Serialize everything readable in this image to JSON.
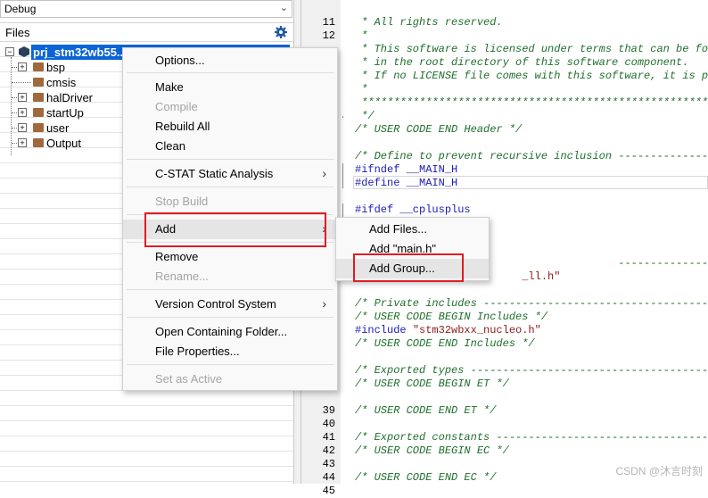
{
  "config": {
    "value": "Debug"
  },
  "files_panel": {
    "title": "Files"
  },
  "tree": {
    "root": "prj_stm32wb55...",
    "groups": [
      {
        "label": "bsp",
        "expandable": true
      },
      {
        "label": "cmsis",
        "expandable": false
      },
      {
        "label": "halDriver",
        "expandable": true
      },
      {
        "label": "startUp",
        "expandable": true
      },
      {
        "label": "user",
        "expandable": true
      },
      {
        "label": "Output",
        "expandable": true
      }
    ]
  },
  "context_menu": {
    "items": [
      {
        "label": "Options...",
        "disabled": false,
        "submenu": false
      },
      {
        "label": "Make",
        "disabled": false,
        "submenu": false
      },
      {
        "label": "Compile",
        "disabled": true,
        "submenu": false
      },
      {
        "label": "Rebuild All",
        "disabled": false,
        "submenu": false
      },
      {
        "label": "Clean",
        "disabled": false,
        "submenu": false
      },
      {
        "label": "C-STAT Static Analysis",
        "disabled": false,
        "submenu": true
      },
      {
        "label": "Stop Build",
        "disabled": true,
        "submenu": false
      },
      {
        "label": "Add",
        "disabled": false,
        "submenu": true
      },
      {
        "label": "Remove",
        "disabled": false,
        "submenu": false
      },
      {
        "label": "Rename...",
        "disabled": true,
        "submenu": false
      },
      {
        "label": "Version Control System",
        "disabled": false,
        "submenu": true
      },
      {
        "label": "Open Containing Folder...",
        "disabled": false,
        "submenu": false
      },
      {
        "label": "File Properties...",
        "disabled": false,
        "submenu": false
      },
      {
        "label": "Set as Active",
        "disabled": true,
        "submenu": false
      }
    ]
  },
  "add_submenu": {
    "items": [
      {
        "label": "Add Files..."
      },
      {
        "label": "Add \"main.h\""
      },
      {
        "label": "Add Group..."
      }
    ]
  },
  "editor": {
    "line_numbers": [
      "11",
      "12",
      "",
      "",
      "",
      "",
      "",
      "",
      "",
      "",
      "",
      "",
      "",
      "",
      "",
      "",
      "",
      "",
      "",
      "",
      "",
      "",
      "",
      "",
      "",
      "",
      "",
      "",
      "",
      "39",
      "40",
      "41",
      "42",
      "43",
      "44",
      "45"
    ],
    "code_lines": [
      {
        "text": " * All rights reserved.",
        "kind": "comment"
      },
      {
        "text": " *",
        "kind": "comment"
      },
      {
        "text": " * This software is licensed under terms that can be fou",
        "kind": "comment"
      },
      {
        "text": " * in the root directory of this software component.",
        "kind": "comment"
      },
      {
        "text": " * If no LICENSE file comes with this software, it is pr",
        "kind": "comment"
      },
      {
        "text": " *",
        "kind": "comment"
      },
      {
        "text": " ******************************************************",
        "kind": "comment"
      },
      {
        "text": " */",
        "kind": "comment"
      },
      {
        "text": "/* USER CODE END Header */",
        "kind": "comment"
      },
      {
        "text": "",
        "kind": "plain"
      },
      {
        "text": "/* Define to prevent recursive inclusion ----------------",
        "kind": "comment"
      },
      {
        "text": "#ifndef __MAIN_H",
        "kind": "pp"
      },
      {
        "text": "#define __MAIN_H",
        "kind": "pp"
      },
      {
        "text": "",
        "kind": "plain"
      },
      {
        "text": "#ifdef __cplusplus",
        "kind": "pp"
      },
      {
        "text": "",
        "kind": "plain"
      },
      {
        "text": "",
        "kind": "plain"
      },
      {
        "text": "",
        "kind": "plain"
      },
      {
        "text": "                                         ----------------",
        "kind": "comment"
      },
      {
        "text": "                          _ll.h\"",
        "kind": "str"
      },
      {
        "text": "",
        "kind": "plain"
      },
      {
        "text": "/* Private includes -------------------------------------",
        "kind": "comment"
      },
      {
        "text": "/* USER CODE BEGIN Includes */",
        "kind": "comment"
      },
      {
        "text": "#include \"stm32wbxx_nucleo.h\"",
        "kind": "include"
      },
      {
        "text": "/* USER CODE END Includes */",
        "kind": "comment"
      },
      {
        "text": "",
        "kind": "plain"
      },
      {
        "text": "/* Exported types ---------------------------------------",
        "kind": "comment"
      },
      {
        "text": "/* USER CODE BEGIN ET */",
        "kind": "comment"
      },
      {
        "text": "",
        "kind": "plain"
      },
      {
        "text": "/* USER CODE END ET */",
        "kind": "comment"
      },
      {
        "text": "",
        "kind": "plain"
      },
      {
        "text": "/* Exported constants -----------------------------------",
        "kind": "comment"
      },
      {
        "text": "/* USER CODE BEGIN EC */",
        "kind": "comment"
      },
      {
        "text": "",
        "kind": "plain"
      },
      {
        "text": "/* USER CODE END EC */",
        "kind": "comment"
      }
    ]
  },
  "icons": {
    "gear": "gear-icon",
    "project": "project-icon",
    "folder": "folder-icon"
  },
  "colors": {
    "selection": "#0a64d6",
    "highlight_box": "#e01c24",
    "comment": "#1f6f2c",
    "preprocessor": "#1a1ab5"
  },
  "watermark": "CSDN @沐言时刻"
}
